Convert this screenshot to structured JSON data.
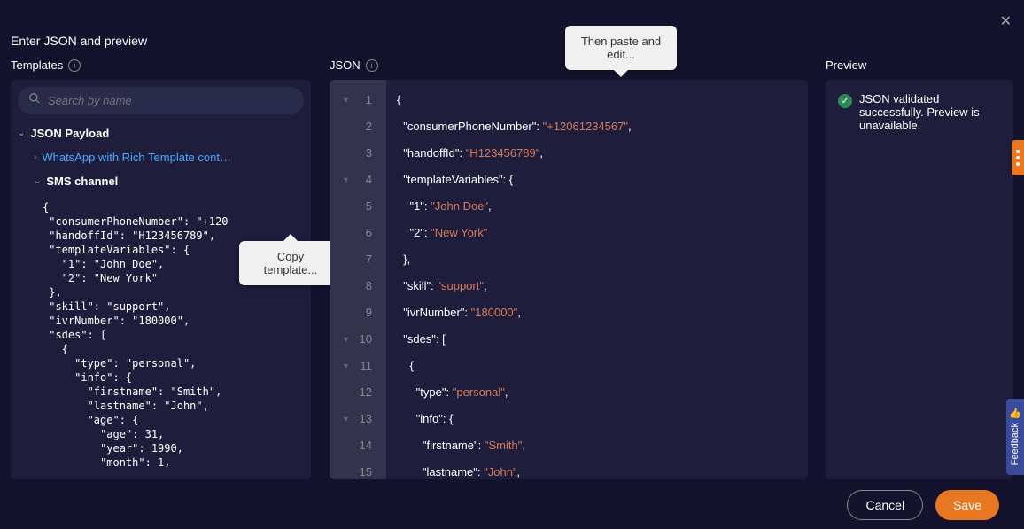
{
  "header": "Enter JSON and preview",
  "col": {
    "templates": "Templates",
    "json": "JSON",
    "preview": "Preview"
  },
  "search": {
    "placeholder": "Search by name"
  },
  "tree": {
    "root": "JSON Payload",
    "item1": "WhatsApp with Rich Template cont…",
    "item2": "SMS channel"
  },
  "dump": "{\n \"consumerPhoneNumber\": \"+120\n \"handoffId\": \"H123456789\",\n \"templateVariables\": {\n   \"1\": \"John Doe\",\n   \"2\": \"New York\"\n },\n \"skill\": \"support\",\n \"ivrNumber\": \"180000\",\n \"sdes\": [\n   {\n     \"type\": \"personal\",\n     \"info\": {\n       \"firstname\": \"Smith\",\n       \"lastname\": \"John\",\n       \"age\": {\n         \"age\": 31,\n         \"year\": 1990,\n         \"month\": 1,",
  "tips": {
    "copy": "Copy template...",
    "paste": "Then paste and edit..."
  },
  "editor": {
    "lines": [
      "1",
      "2",
      "3",
      "4",
      "5",
      "6",
      "7",
      "8",
      "9",
      "10",
      "11",
      "12",
      "13",
      "14",
      "15"
    ],
    "fold": [
      0,
      3,
      9,
      10,
      12
    ],
    "rows": [
      [
        [
          "{",
          "k"
        ]
      ],
      [
        [
          "  ",
          "k"
        ],
        [
          "\"consumerPhoneNumber\"",
          "k"
        ],
        [
          ": ",
          "k"
        ],
        [
          "\"+12061234567\"",
          "s"
        ],
        [
          ",",
          "k"
        ]
      ],
      [
        [
          "  ",
          "k"
        ],
        [
          "\"handoffId\"",
          "k"
        ],
        [
          ": ",
          "k"
        ],
        [
          "\"H123456789\"",
          "s"
        ],
        [
          ",",
          "k"
        ]
      ],
      [
        [
          "  ",
          "k"
        ],
        [
          "\"templateVariables\"",
          "k"
        ],
        [
          ": {",
          "k"
        ]
      ],
      [
        [
          "    ",
          "k"
        ],
        [
          "\"1\"",
          "k"
        ],
        [
          ": ",
          "k"
        ],
        [
          "\"John Doe\"",
          "s"
        ],
        [
          ",",
          "k"
        ]
      ],
      [
        [
          "    ",
          "k"
        ],
        [
          "\"2\"",
          "k"
        ],
        [
          ": ",
          "k"
        ],
        [
          "\"New York\"",
          "s"
        ]
      ],
      [
        [
          "  },",
          "k"
        ]
      ],
      [
        [
          "  ",
          "k"
        ],
        [
          "\"skill\"",
          "k"
        ],
        [
          ": ",
          "k"
        ],
        [
          "\"support\"",
          "s"
        ],
        [
          ",",
          "k"
        ]
      ],
      [
        [
          "  ",
          "k"
        ],
        [
          "\"ivrNumber\"",
          "k"
        ],
        [
          ": ",
          "k"
        ],
        [
          "\"180000\"",
          "s"
        ],
        [
          ",",
          "k"
        ]
      ],
      [
        [
          "  ",
          "k"
        ],
        [
          "\"sdes\"",
          "k"
        ],
        [
          ": [",
          "k"
        ]
      ],
      [
        [
          "    {",
          "k"
        ]
      ],
      [
        [
          "      ",
          "k"
        ],
        [
          "\"type\"",
          "k"
        ],
        [
          ": ",
          "k"
        ],
        [
          "\"personal\"",
          "s"
        ],
        [
          ",",
          "k"
        ]
      ],
      [
        [
          "      ",
          "k"
        ],
        [
          "\"info\"",
          "k"
        ],
        [
          ": {",
          "k"
        ]
      ],
      [
        [
          "        ",
          "k"
        ],
        [
          "\"firstname\"",
          "k"
        ],
        [
          ": ",
          "k"
        ],
        [
          "\"Smith\"",
          "s"
        ],
        [
          ",",
          "k"
        ]
      ],
      [
        [
          "        ",
          "k"
        ],
        [
          "\"lastname\"",
          "k"
        ],
        [
          ": ",
          "k"
        ],
        [
          "\"John\"",
          "s"
        ],
        [
          ",",
          "k"
        ]
      ]
    ]
  },
  "preview": {
    "msg": "JSON validated successfully. Preview is unavailable."
  },
  "feedback": "Feedback",
  "btn": {
    "cancel": "Cancel",
    "save": "Save"
  }
}
